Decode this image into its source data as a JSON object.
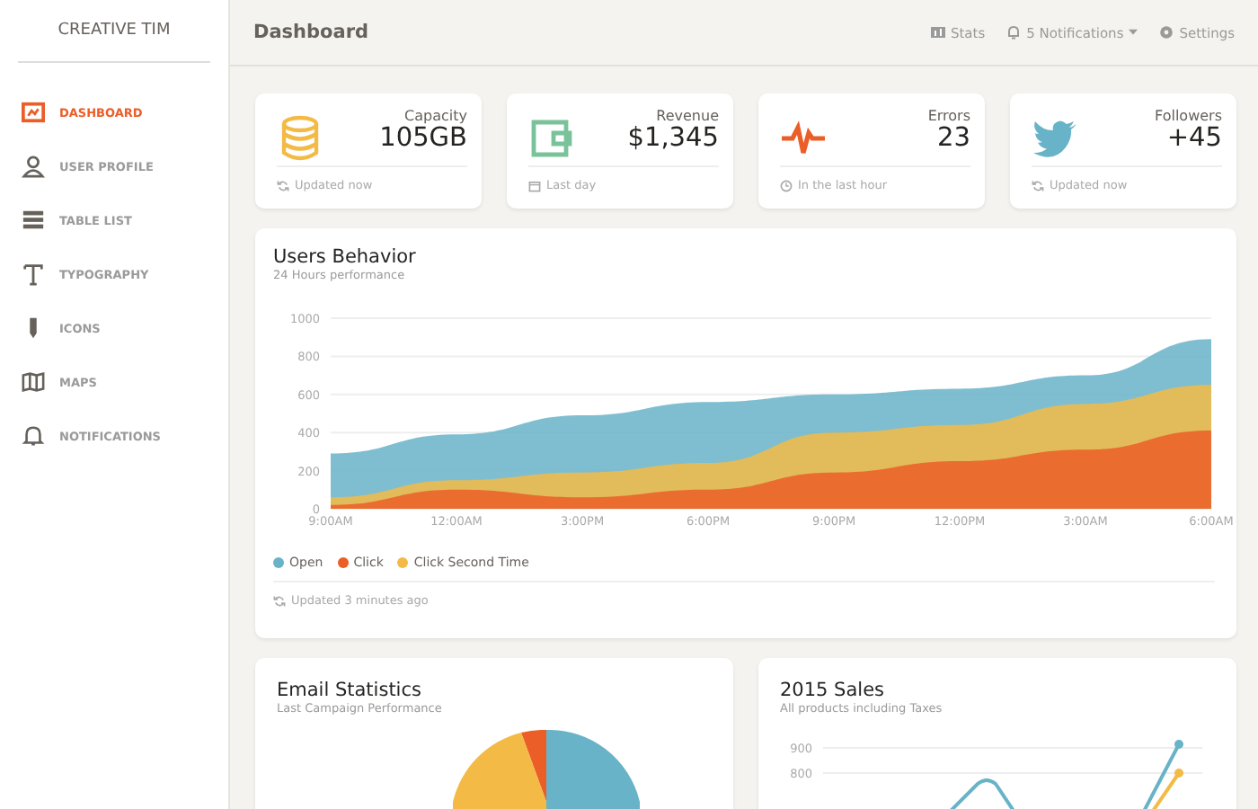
{
  "sidebar": {
    "brand": "CREATIVE TIM",
    "items": [
      {
        "label": "DASHBOARD",
        "selected": true
      },
      {
        "label": "USER PROFILE",
        "selected": false
      },
      {
        "label": "TABLE LIST",
        "selected": false
      },
      {
        "label": "TYPOGRAPHY",
        "selected": false
      },
      {
        "label": "ICONS",
        "selected": false
      },
      {
        "label": "MAPS",
        "selected": false
      },
      {
        "label": "NOTIFICATIONS",
        "selected": false
      }
    ]
  },
  "navbar": {
    "title": "Dashboard",
    "links": [
      {
        "kind": "stats",
        "label": "Stats"
      },
      {
        "kind": "dropdown",
        "label": "5 Notifications"
      },
      {
        "kind": "settings",
        "label": "Settings"
      }
    ]
  },
  "stat_cards": [
    {
      "kind": "database",
      "label": "Capacity",
      "value": "105GB",
      "footer": "Updated now"
    },
    {
      "kind": "wallet",
      "label": "Revenue",
      "value": "$1,345",
      "footer": "Last day"
    },
    {
      "kind": "pulse",
      "label": "Errors",
      "value": "23",
      "footer": "In the last hour"
    },
    {
      "kind": "bird",
      "label": "Followers",
      "value": "+45",
      "footer": "Updated now"
    }
  ],
  "users_behavior": {
    "title": "Users Behavior",
    "subtitle": "24 Hours performance",
    "chart_data": {
      "type": "area",
      "categories": [
        "9:00AM",
        "12:00AM",
        "3:00PM",
        "6:00PM",
        "9:00PM",
        "12:00PM",
        "3:00AM",
        "6:00AM"
      ],
      "ylim": [
        0,
        1000
      ],
      "yticks": [
        0,
        200,
        400,
        600,
        800,
        1000
      ],
      "stacked": false,
      "grid": true,
      "series": [
        {
          "name": "Open",
          "color": "#68b3c8",
          "values": [
            290,
            390,
            490,
            560,
            600,
            630,
            700,
            890
          ]
        },
        {
          "name": "Click",
          "color": "#eb5e28",
          "values": [
            20,
            100,
            60,
            100,
            190,
            250,
            310,
            410
          ]
        },
        {
          "name": "Click Second Time",
          "color": "#f3bb45",
          "values": [
            60,
            150,
            190,
            240,
            400,
            440,
            550,
            650
          ]
        }
      ]
    },
    "footer": "Updated 3 minutes ago"
  },
  "email_statistics": {
    "title": "Email Statistics",
    "subtitle": "Last Campaign Performance"
  },
  "sales": {
    "title": "2015 Sales",
    "subtitle": "All products including Taxes",
    "axis_labels": [
      "900",
      "800"
    ]
  }
}
